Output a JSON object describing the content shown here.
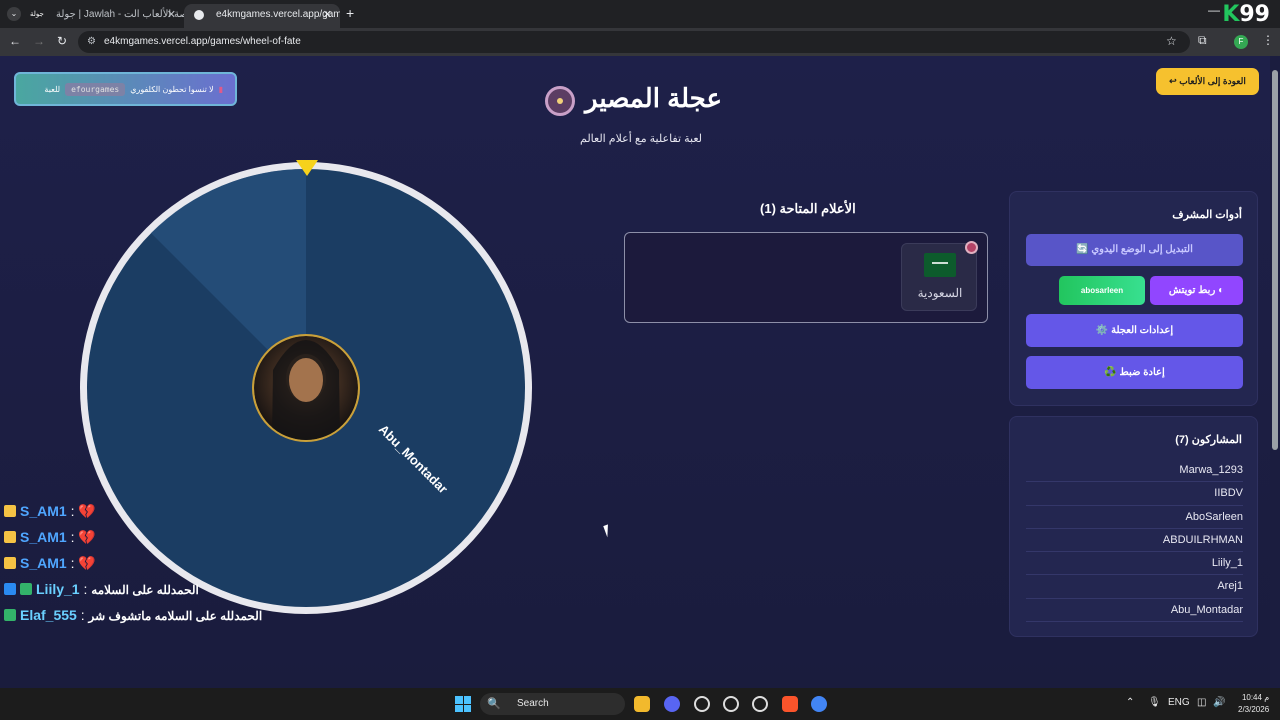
{
  "browser": {
    "tabs": [
      {
        "label": "جولة | Jawlah - منصة الألعاب الت...",
        "favicon": "جولة"
      },
      {
        "label": "e4kmgames.vercel.app/games/..."
      }
    ],
    "url": "e4kmgames.vercel.app/games/wheel-of-fate",
    "corner_badge": {
      "k": "K",
      "num": "99"
    }
  },
  "promo": {
    "text": "لا تنسوا تحطون الكلفوري",
    "code": "efourgames",
    "suffix": "للعبة"
  },
  "back_button": "↩ العودة إلى الألعاب",
  "header": {
    "title": "عجلة المصير",
    "subtitle": "لعبة تفاعلية مع أعلام العالم"
  },
  "wheel": {
    "segment_label": "Abu_Montadar",
    "colors": {
      "rim": "#e8e8ee",
      "fill": "#1b3d63",
      "highlight": "#2c5785",
      "pointer": "#f6d21c"
    }
  },
  "flags": {
    "title": "الأعلام المتاحة (1)",
    "items": [
      {
        "name": "السعودية"
      }
    ]
  },
  "admin": {
    "title": "أدوات المشرف",
    "manual_mode": "🔄 التبديل إلى الوضع اليدوي",
    "twitch_connect": "ربط تويتش",
    "twitch_user": "abosarleen",
    "wheel_settings": "⚙️ إعدادات العجلة",
    "reset": "♻️ إعادة ضبط"
  },
  "participants": {
    "title": "المشاركون (7)",
    "items": [
      "Marwa_1293",
      "IIBDV",
      "AboSarleen",
      "ABDUILRHMAN",
      "Liily_1",
      "Arej1",
      "Abu_Montadar"
    ]
  },
  "chat": [
    {
      "user": "S_AM1",
      "message": "",
      "heart": "💔"
    },
    {
      "user": "S_AM1",
      "message": "",
      "heart": "💔"
    },
    {
      "user": "S_AM1",
      "message": "",
      "heart": "💔"
    },
    {
      "user": "Liily_1",
      "message": "الحمدلله على السلامه"
    },
    {
      "user": "Elaf_555",
      "message": "الحمدلله على السلامه ماتشوف شر"
    }
  ],
  "taskbar": {
    "search": "Search",
    "lang": "ENG",
    "time": "10:44 م",
    "date": "2/3/2026"
  }
}
